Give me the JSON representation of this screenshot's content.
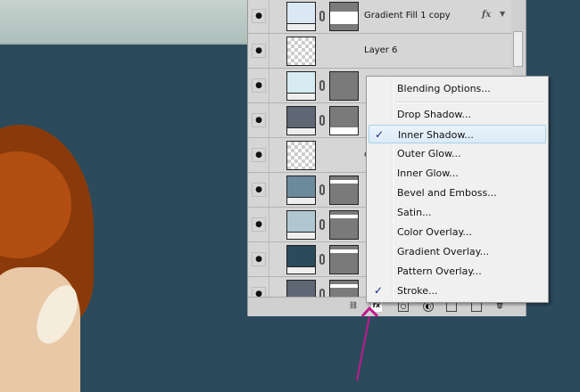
{
  "layers": [
    {
      "name": "Gradient Fill 1 copy",
      "thumb": "#dbe7f3",
      "mask": "top-white",
      "fx": "fx"
    },
    {
      "name": "Layer 6",
      "thumb": "checker"
    },
    {
      "name": "",
      "thumb": "#d7ecf2",
      "mask": "gray"
    },
    {
      "name": "",
      "thumb": "#5f6674",
      "mask": "bottom-white"
    },
    {
      "name": "cartoon",
      "thumb": "checker"
    },
    {
      "name": "",
      "thumb": "#6b8a9b",
      "mask": "gray"
    },
    {
      "name": "",
      "thumb": "#b0c6d0",
      "mask": "gray"
    },
    {
      "name": "",
      "thumb": "#2b4a5c",
      "mask": "gray"
    },
    {
      "name": "",
      "thumb": "#5f6674",
      "mask": "gray"
    }
  ],
  "menu": {
    "items": [
      {
        "label": "Blending Options...",
        "checked": false
      },
      {
        "label": "Drop Shadow...",
        "checked": false
      },
      {
        "label": "Inner Shadow...",
        "checked": true,
        "selected": true
      },
      {
        "label": "Outer Glow...",
        "checked": false
      },
      {
        "label": "Inner Glow...",
        "checked": false
      },
      {
        "label": "Bevel and Emboss...",
        "checked": false
      },
      {
        "label": "Satin...",
        "checked": false
      },
      {
        "label": "Color Overlay...",
        "checked": false
      },
      {
        "label": "Gradient Overlay...",
        "checked": false
      },
      {
        "label": "Pattern Overlay...",
        "checked": false
      },
      {
        "label": "Stroke...",
        "checked": true
      }
    ],
    "check": "✓"
  },
  "fx_label": "fx",
  "colors": {
    "background": "#2b4a5c",
    "arrow": "#c2188f"
  }
}
